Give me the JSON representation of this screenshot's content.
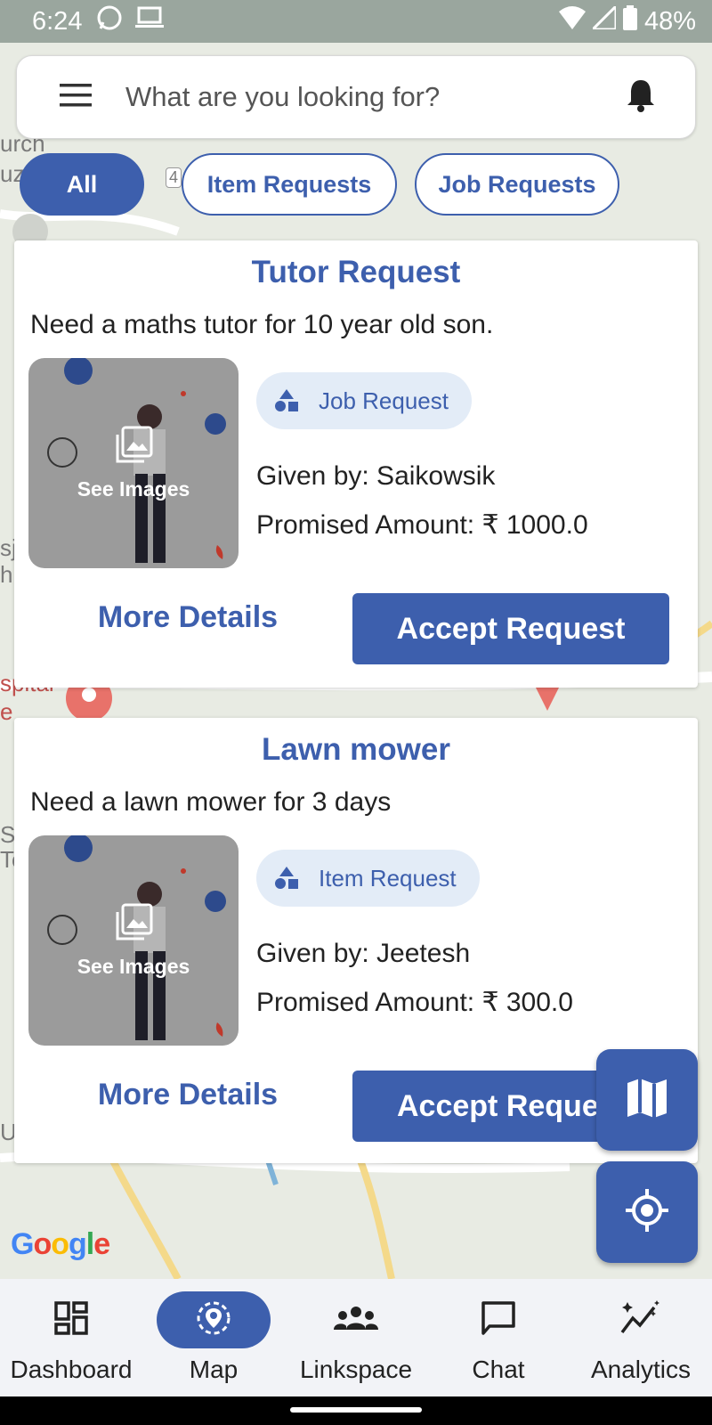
{
  "status_bar": {
    "time": "6:24",
    "battery": "48%"
  },
  "search": {
    "placeholder": "What are you looking for?"
  },
  "filters": [
    {
      "label": "All",
      "active": true
    },
    {
      "label": "Item Requests",
      "active": false
    },
    {
      "label": "Job Requests",
      "active": false
    }
  ],
  "map": {
    "labels": [
      "urch",
      "uz",
      "sj",
      "h",
      "spital",
      "e",
      "S",
      "Te",
      "U"
    ],
    "highway_marker": "4",
    "google": [
      "G",
      "o",
      "o",
      "g",
      "l",
      "e"
    ]
  },
  "cards": [
    {
      "title": "Tutor Request",
      "description": "Need a maths tutor for 10 year old son.",
      "thumbnail_label": "See Images",
      "type": "Job Request",
      "given_by": "Given by: Saikowsik",
      "promised_amount": "Promised Amount: ₹ 1000.0",
      "more_label": "More Details",
      "accept_label": "Accept Request"
    },
    {
      "title": "Lawn mower",
      "description": "Need a lawn mower for 3 days",
      "thumbnail_label": "See Images",
      "type": "Item Request",
      "given_by": "Given by: Jeetesh",
      "promised_amount": "Promised Amount: ₹ 300.0",
      "more_label": "More Details",
      "accept_label": "Accept Request"
    }
  ],
  "nav": [
    {
      "label": "Dashboard",
      "icon": "dashboard-icon",
      "active": false
    },
    {
      "label": "Map",
      "icon": "map-pin-icon",
      "active": true
    },
    {
      "label": "Linkspace",
      "icon": "group-icon",
      "active": false
    },
    {
      "label": "Chat",
      "icon": "chat-icon",
      "active": false
    },
    {
      "label": "Analytics",
      "icon": "analytics-icon",
      "active": false
    }
  ],
  "colors": {
    "primary": "#3d5fad",
    "badge_bg": "#e3ecf7",
    "thumb_bg": "#9b9b9b"
  }
}
